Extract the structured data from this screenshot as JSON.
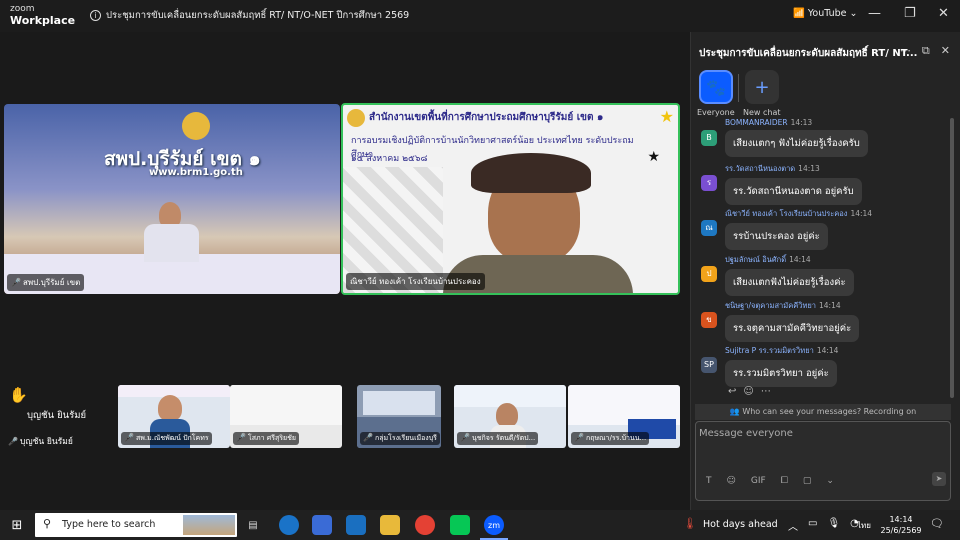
{
  "window": {
    "logo_top": "zoom",
    "logo_bottom": "Workplace",
    "title": "ประชุมการขับเคลื่อนยกระดับผลสัมฤทธิ์ RT/ NT/O-NET ปีการศึกษา 2569",
    "youtube_label": "YouTube",
    "colors": {
      "accent": "#0b5cff",
      "speaking": "#35c15a",
      "raise_hand": "#f2c23a"
    }
  },
  "stage": {
    "tile_a": {
      "label": "สพป.บุรีรัมย์ เขต",
      "banner": "สพป.บุรีรัมย์ เขต ๑",
      "url": "www.brm1.go.th"
    },
    "tile_b": {
      "label": "ณิชาวีย์ ทองเค้า โรงเรียนบ้านประคอง",
      "slide_title": "สำนักงานเขตพื้นที่การศึกษาประถมศึกษาบุรีรัมย์ เขต ๑",
      "slide_sub": "การอบรมเชิงปฏิบัติการบ้านนักวิทยาศาสตร์น้อย ประเทศไทย ระดับประถมศึกษา",
      "slide_date": "๑๕ สิงหาคม ๒๕๖๘"
    },
    "raised_hand_name": "บุญชัน ยินรัมย์",
    "self_label": "บุญชัน ยินรัมย์",
    "thumbs": [
      {
        "label": "สพ.ม.ณัชพัฒน์ ปักโคทร"
      },
      {
        "label": "โสภา ศรีสุริยชัย"
      },
      {
        "label": "กลุ่มโรงเรียนเมืองบุรี"
      },
      {
        "label": "นุชกิจร รัตนดี/รัตป..."
      },
      {
        "label": "กฤษณา/รร.บ้านน..."
      }
    ]
  },
  "chat": {
    "title": "ประชุมการขับเคลื่อนยกระดับผลสัมฤทธิ์ RT/ NT...",
    "tabs": {
      "everyone": "Everyone",
      "new_chat": "New chat"
    },
    "messages": [
      {
        "sender": "BOMMANRAIDER",
        "time": "14:13",
        "avatar": "B",
        "avatar_color": "#2d9e78",
        "text": "เสียงแตกๆ ฟังไม่ค่อยรู้เรื่องครับ"
      },
      {
        "sender": "รร.วัดสถานีหนองตาด",
        "time": "14:13",
        "avatar": "ร",
        "avatar_color": "#7a4fd1",
        "text": "รร.วัดสถานีหนองตาด  อยู่ครับ"
      },
      {
        "sender": "ณิชาวีย์  ทองเค้า โรงเรียนบ้านประคอง",
        "time": "14:14",
        "avatar": "ณ",
        "avatar_color": "#1e78c2",
        "text": "รรบ้านประคอง  อยู่ค่ะ"
      },
      {
        "sender": "ปฐมลักษณ์ อินศักดิ์",
        "time": "14:14",
        "avatar": "ป",
        "avatar_color": "#f2a31a",
        "text": "เสียงแตกฟังไม่ค่อยรู้เรื่องค่ะ"
      },
      {
        "sender": "ชนิษฐา/จตุคามสามัคคีวิทยา",
        "time": "14:14",
        "avatar": "ข",
        "avatar_color": "#d9531e",
        "text": "รร.จตุคามสามัคคีวิทยาอยู่ค่ะ"
      },
      {
        "sender": "Sujitra P รร.รวมมิตรวิทยา",
        "time": "14:14",
        "avatar": "SP",
        "avatar_color": "#46556e",
        "text": "รร.รวมมิตรวิทยา อยู่ค่ะ"
      }
    ],
    "privacy_note": "Who can see your messages? Recording on",
    "composer_placeholder": "Message everyone",
    "gif_label": "GIF"
  },
  "taskbar": {
    "search_placeholder": "Type here to search",
    "weather": "Hot days ahead",
    "language": "ไทย",
    "time": "14:14",
    "date": "25/6/2569"
  }
}
